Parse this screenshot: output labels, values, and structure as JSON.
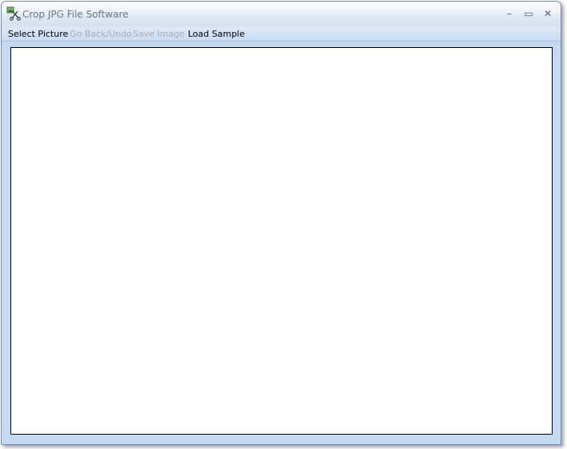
{
  "window": {
    "title": "Crop JPG File Software",
    "controls": {
      "minimize": "–",
      "maximize": "▭",
      "close": "✕"
    }
  },
  "menu": {
    "items": [
      {
        "label": "Select Picture",
        "enabled": true
      },
      {
        "label": "Go Back/Undo",
        "enabled": false
      },
      {
        "label": "Save Image",
        "enabled": false
      },
      {
        "label": "Load Sample",
        "enabled": true
      }
    ]
  },
  "icons": {
    "app": "scissors-image-icon"
  },
  "colors": {
    "frame": "#c4d8f1",
    "menu_text": "#000000",
    "menu_disabled": "#a8aeb8",
    "canvas": "#ffffff"
  }
}
